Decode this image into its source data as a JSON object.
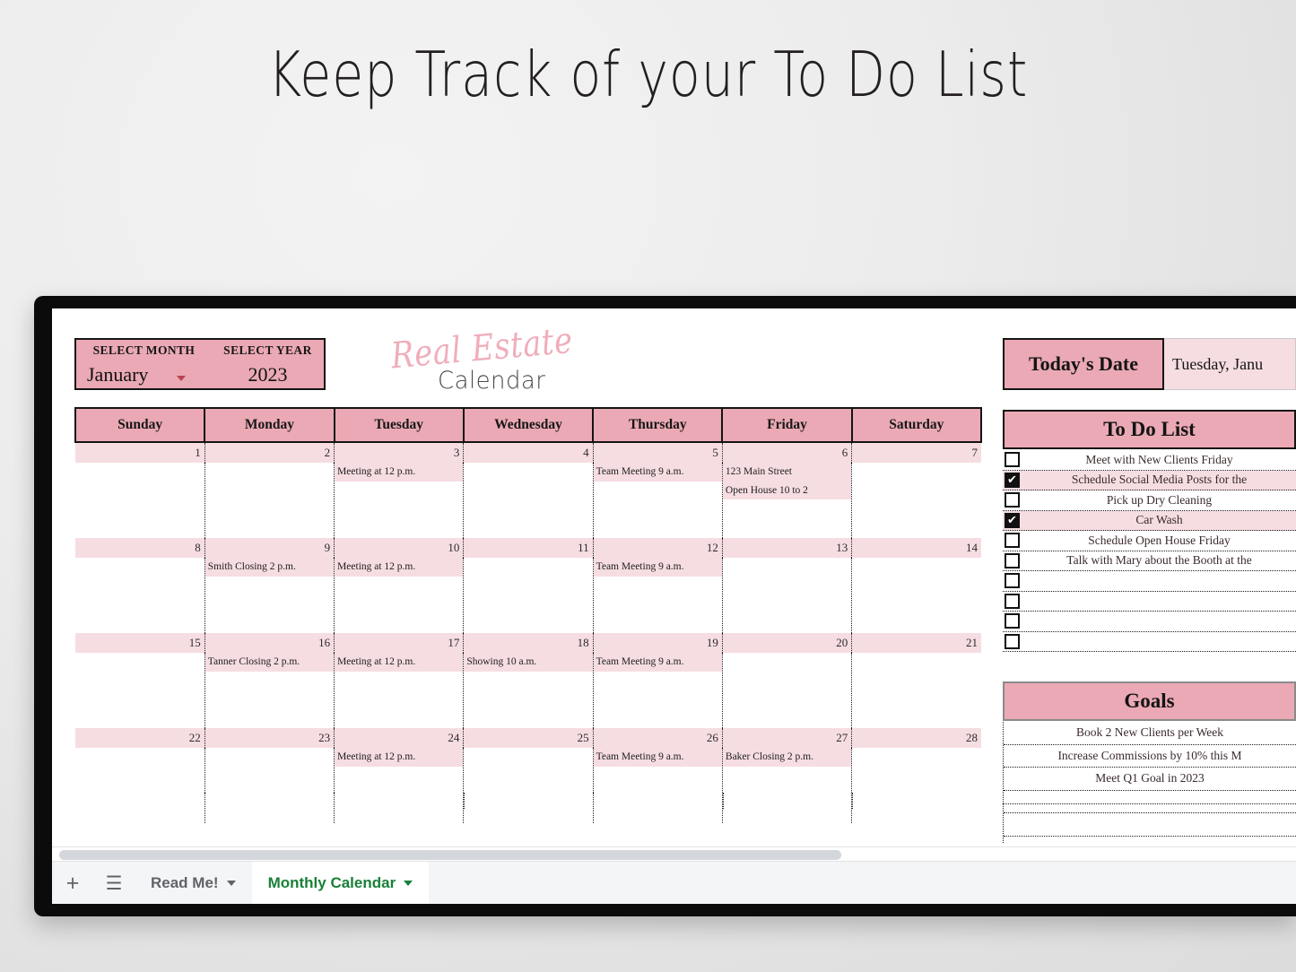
{
  "page": {
    "title": "Keep Track of your To Do List"
  },
  "controls": {
    "month_label": "SELECT MONTH",
    "year_label": "SELECT YEAR",
    "month_value": "January",
    "year_value": "2023"
  },
  "logo": {
    "script": "Real Estate",
    "sub": "Calendar"
  },
  "calendar": {
    "weekdays": [
      "Sunday",
      "Monday",
      "Tuesday",
      "Wednesday",
      "Thursday",
      "Friday",
      "Saturday"
    ],
    "weeks": [
      {
        "days": [
          "1",
          "2",
          "3",
          "4",
          "5",
          "6",
          "7"
        ],
        "events": [
          "",
          "",
          "Meeting at 12 p.m.",
          "",
          "Team Meeting 9 a.m.",
          "123 Main Street\nOpen House 10 to 2",
          ""
        ]
      },
      {
        "days": [
          "8",
          "9",
          "10",
          "11",
          "12",
          "13",
          "14"
        ],
        "events": [
          "",
          "Smith Closing 2 p.m.",
          "Meeting at 12 p.m.",
          "",
          "Team Meeting 9 a.m.",
          "",
          ""
        ]
      },
      {
        "days": [
          "15",
          "16",
          "17",
          "18",
          "19",
          "20",
          "21"
        ],
        "events": [
          "",
          "Tanner Closing 2 p.m.",
          "Meeting at 12 p.m.",
          "Showing 10 a.m.",
          "Team Meeting 9 a.m.",
          "",
          ""
        ]
      },
      {
        "days": [
          "22",
          "23",
          "24",
          "25",
          "26",
          "27",
          "28"
        ],
        "events": [
          "",
          "",
          "Meeting at 12 p.m.",
          "",
          "Team Meeting 9 a.m.",
          "Baker Closing 2 p.m.",
          ""
        ]
      }
    ]
  },
  "today": {
    "label": "Today's  Date",
    "value": "Tuesday, Janu"
  },
  "todo": {
    "title": "To Do List",
    "items": [
      {
        "checked": false,
        "text": "Meet with New Clients Friday"
      },
      {
        "checked": true,
        "text": "Schedule Social Media Posts for the"
      },
      {
        "checked": false,
        "text": "Pick up Dry Cleaning"
      },
      {
        "checked": true,
        "text": "Car Wash"
      },
      {
        "checked": false,
        "text": "Schedule Open House Friday"
      },
      {
        "checked": false,
        "text": "Talk with Mary about the Booth at the "
      },
      {
        "checked": false,
        "text": ""
      },
      {
        "checked": false,
        "text": ""
      },
      {
        "checked": false,
        "text": ""
      },
      {
        "checked": false,
        "text": ""
      }
    ]
  },
  "goals": {
    "title": "Goals",
    "items": [
      "Book 2 New Clients per Week",
      "Increase Commissions by 10% this M",
      "Meet Q1 Goal in 2023",
      "",
      "",
      "",
      ""
    ]
  },
  "tabs": {
    "add_label": "+",
    "menu_label": "☰",
    "sheets": [
      {
        "label": "Read Me!",
        "active": false
      },
      {
        "label": "Monthly Calendar",
        "active": true
      }
    ]
  },
  "colors": {
    "header_pink": "#eaa9b4",
    "row_pink": "#f6dde2",
    "accent_green": "#188038",
    "bezel": "#0b0b0b"
  }
}
